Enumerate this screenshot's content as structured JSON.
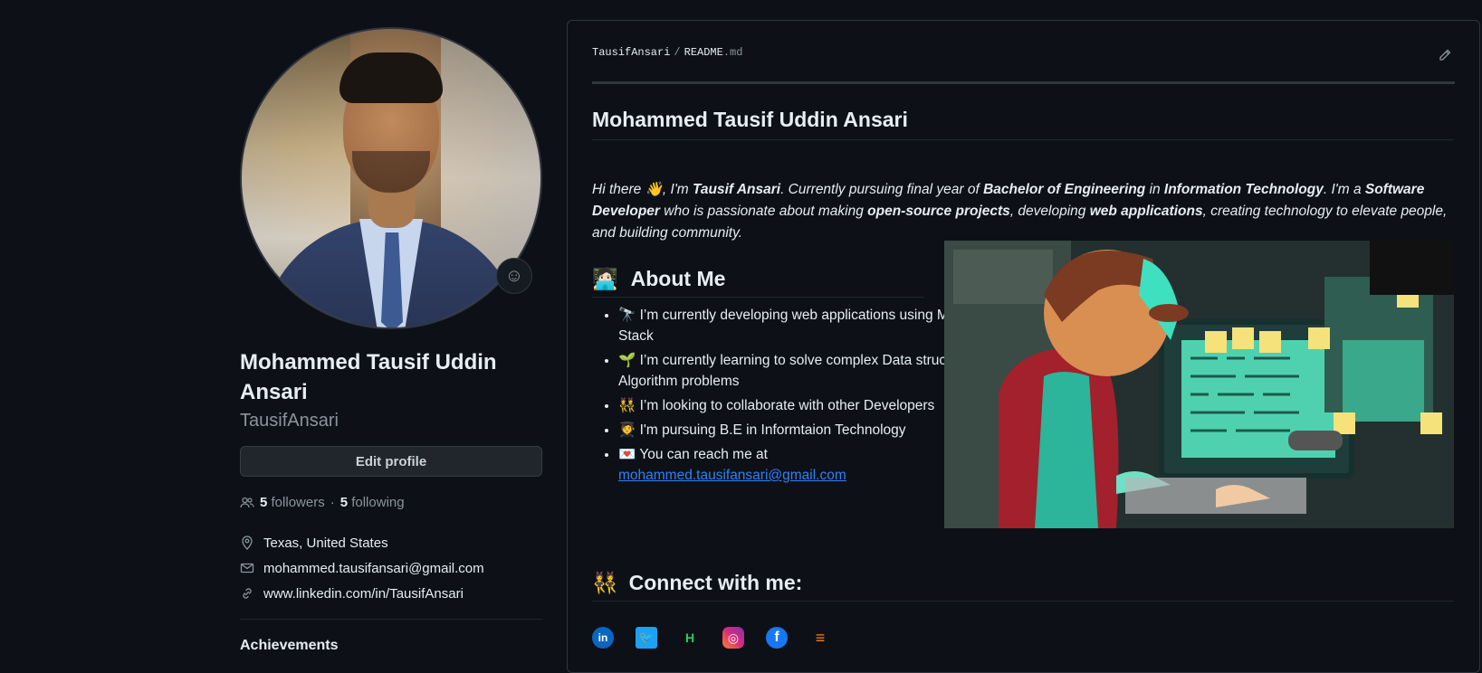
{
  "profile": {
    "name": "Mohammed Tausif Uddin Ansari",
    "login": "TausifAnsari",
    "edit_label": "Edit profile",
    "followers_count": "5",
    "followers_label": "followers",
    "dot": "·",
    "following_count": "5",
    "following_label": "following",
    "location": "Texas, United States",
    "email": "mohammed.tausifansari@gmail.com",
    "website": "www.linkedin.com/in/TausifAnsari",
    "achievements_title": "Achievements"
  },
  "readme": {
    "owner": "TausifAnsari",
    "separator": "/",
    "file_base": "README",
    "file_ext": ".md",
    "title": "Mohammed Tausif Uddin Ansari",
    "intro": {
      "p1": "Hi there ",
      "wave": "👋",
      "p2": ", I'm ",
      "b1": "Tausif Ansari",
      "p3": ". Currently pursuing final year of ",
      "b2": "Bachelor of Engineering",
      "p4": " in ",
      "b3": "Information Technology",
      "p5": ". I'm a ",
      "b4": "Software Developer",
      "p6": " who is passionate about making ",
      "b5": "open-source projects",
      "p7": ", developing ",
      "b6": "web applications",
      "p8": ", creating technology to elevate people, and building community."
    },
    "about_emoji": "🧑🏻‍💻",
    "about_title": "About Me",
    "about_items": [
      {
        "emoji": "🔭",
        "text": "I’m currently developing web applications using MERN Stack"
      },
      {
        "emoji": "🌱",
        "text": "I’m currently learning to solve complex Data structure and Algorithm problems"
      },
      {
        "emoji": "👯",
        "text": "I’m looking to collaborate with other Developers"
      },
      {
        "emoji": "🧑‍🎓",
        "text": "I'm pursuing B.E in Informtaion Technology"
      },
      {
        "emoji": "💌",
        "text": "You can reach me at",
        "link": "mohammed.tausifansari@gmail.com"
      }
    ],
    "connect_emoji": "👯",
    "connect_title": "Connect with me:",
    "socials": [
      {
        "name": "linkedin",
        "glyph": "in",
        "color": "#0a66c2"
      },
      {
        "name": "twitter",
        "glyph": "🐦",
        "color": "#1da1f2"
      },
      {
        "name": "hackerrank",
        "glyph": "H",
        "color": "#0d1117"
      },
      {
        "name": "instagram",
        "glyph": "◎",
        "color": "#e1306c"
      },
      {
        "name": "facebook",
        "glyph": "f",
        "color": "#1877f2"
      },
      {
        "name": "stackoverflow",
        "glyph": "≡",
        "color": "#f48024"
      }
    ]
  },
  "icons": {
    "emoji": "smiley-icon",
    "people": "people-icon",
    "location": "location-icon",
    "mail": "mail-icon",
    "link": "link-icon",
    "pencil": "pencil-icon"
  },
  "colors": {
    "background": "#0d1117",
    "link": "#2f81f7",
    "border": "#30363d",
    "muted": "#8b949e"
  }
}
